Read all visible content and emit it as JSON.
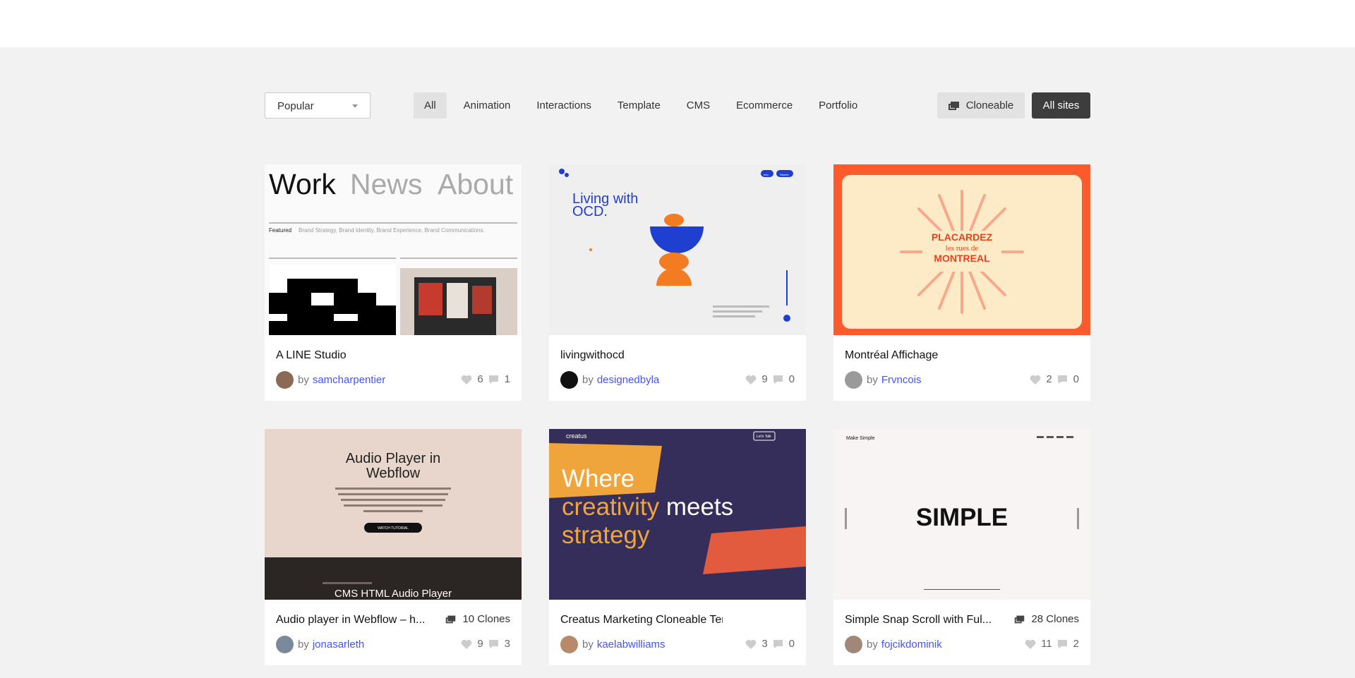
{
  "toolbar": {
    "sort": "Popular",
    "filters": [
      "All",
      "Animation",
      "Interactions",
      "Template",
      "CMS",
      "Ecommerce",
      "Portfolio"
    ],
    "active_filter": "All",
    "cloneable_label": "Cloneable",
    "allsites_label": "All sites"
  },
  "cards": [
    {
      "title": "A LINE Studio",
      "author": "samcharpentier",
      "likes": "6",
      "comments": "1",
      "clones": "",
      "thumb": {
        "nav": [
          "Work",
          "News",
          "About"
        ],
        "featured": "Featured",
        "tags": "Brand Strategy, Brand Identity, Brand Experience, Brand Communications."
      }
    },
    {
      "title": "livingwithocd",
      "author": "designedbyla",
      "likes": "9",
      "comments": "0",
      "clones": "",
      "thumb": {
        "headline_1": "Living with",
        "headline_2": "OCD.",
        "pill_1": "Info",
        "pill_2": "Stories"
      }
    },
    {
      "title": "Montréal Affichage",
      "author": "Frvncois",
      "likes": "2",
      "comments": "0",
      "clones": "",
      "thumb": {
        "line_1": "PLACARDEZ",
        "line_2": "les rues de",
        "line_3": "MONTREAL"
      }
    },
    {
      "title": "Audio player in Webflow – h...",
      "author": "jonasarleth",
      "likes": "9",
      "comments": "3",
      "clones": "10 Clones",
      "thumb": {
        "heading_1": "Audio Player in",
        "heading_2": "Webflow",
        "button": "WATCH TUTORIAL",
        "footer": "CMS HTML Audio Player"
      }
    },
    {
      "title": "Creatus Marketing Cloneable Template",
      "author": "kaelabwilliams",
      "likes": "3",
      "comments": "0",
      "clones": "",
      "thumb": {
        "brand": "creatus",
        "cta": "Let's Talk",
        "line_1": "Where",
        "line_2a": "creativity",
        "line_2b": " meets",
        "line_3": "strategy"
      }
    },
    {
      "title": "Simple Snap Scroll with Ful...",
      "author": "fojcikdominik",
      "likes": "11",
      "comments": "2",
      "clones": "28 Clones",
      "thumb": {
        "brand": "Make Simple",
        "word": "SIMPLE"
      }
    }
  ],
  "colors": {
    "link": "#4353ff",
    "dark_button": "#3d3d3d",
    "page_bg": "#f2f2f2"
  }
}
